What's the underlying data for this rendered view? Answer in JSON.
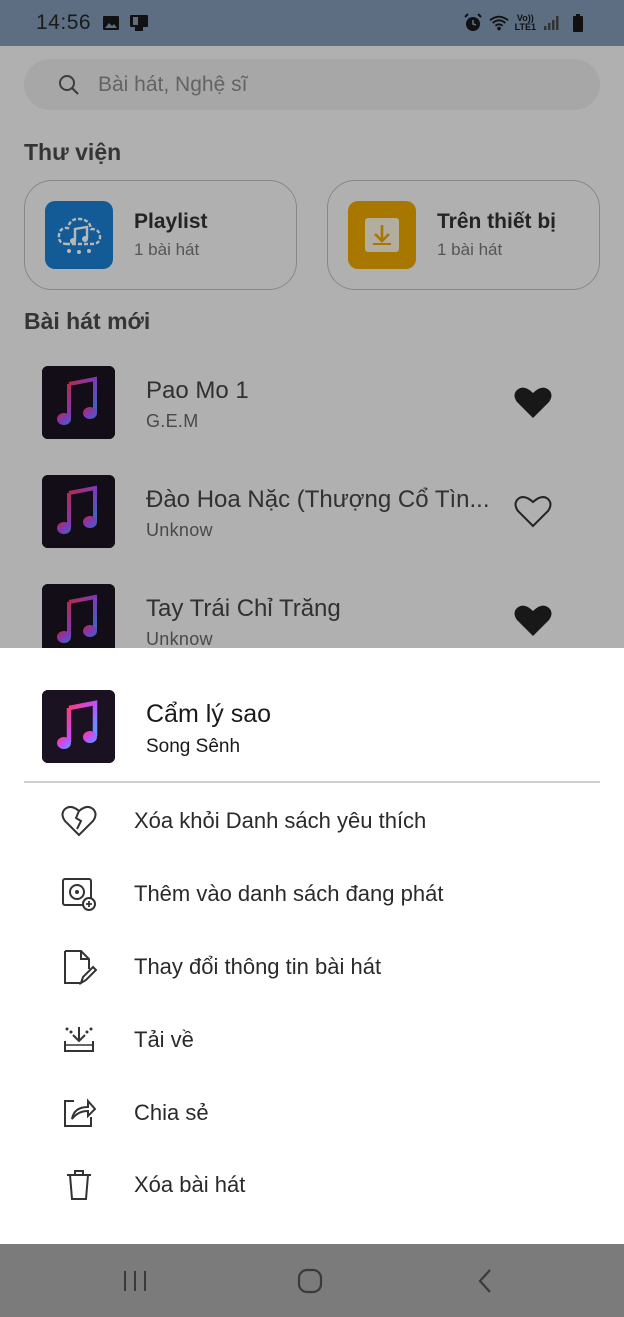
{
  "status_bar": {
    "time": "14:56",
    "left_icons": [
      "image-icon",
      "notification-icon"
    ],
    "right_icons": [
      "alarm-icon",
      "wifi-icon",
      "volte-lte-icon",
      "signal-icon",
      "battery-icon"
    ],
    "network_line1": "Vo))",
    "network_line2": "LTE1"
  },
  "search": {
    "placeholder": "Bài hát, Nghệ sĩ",
    "icon": "search-icon"
  },
  "library": {
    "title": "Thư viện",
    "cards": [
      {
        "title": "Playlist",
        "subtitle": "1 bài hát",
        "icon": "cloud-music-icon",
        "color": "#1b7fd0"
      },
      {
        "title": "Trên thiết bị",
        "subtitle": "1 bài hát",
        "icon": "download-icon",
        "color": "#e8a600"
      }
    ]
  },
  "new_songs": {
    "title": "Bài hát mới",
    "items": [
      {
        "title": "Pao Mo 1",
        "artist": "G.E.M",
        "liked": true
      },
      {
        "title": "Đào Hoa Nặc (Thượng Cổ Tìn...",
        "artist": "Unknow",
        "liked": false
      },
      {
        "title": "Tay Trái Chỉ Trăng",
        "artist": "Unknow",
        "liked": true
      }
    ]
  },
  "sheet": {
    "song_title": "Cẩm lý sao",
    "song_artist": "Song Sênh",
    "actions": [
      {
        "label": "Xóa khỏi Danh sách yêu thích",
        "icon": "broken-heart-icon"
      },
      {
        "label": "Thêm vào danh sách đang phát",
        "icon": "add-to-queue-icon"
      },
      {
        "label": "Thay đổi thông tin bài hát",
        "icon": "edit-file-icon"
      },
      {
        "label": "Tải về",
        "icon": "download-tray-icon"
      },
      {
        "label": "Chia sẻ",
        "icon": "share-icon"
      },
      {
        "label": "Xóa bài hát",
        "icon": "trash-icon"
      }
    ]
  },
  "nav_bar": {
    "buttons": [
      "recent-apps-icon",
      "home-icon",
      "back-icon"
    ]
  },
  "colors": {
    "status_bar": "#5d6e82",
    "nav_bar": "#7b7b7b",
    "playlist_accent": "#1b7fd0",
    "device_accent": "#e8a600"
  }
}
